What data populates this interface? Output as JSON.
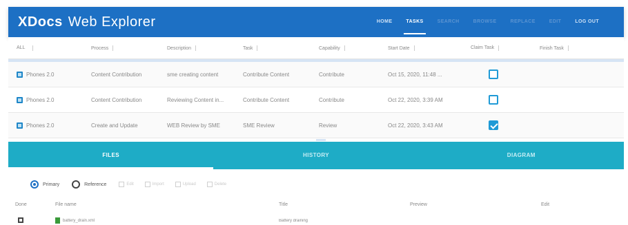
{
  "app": {
    "brand_bold": "XDocs",
    "brand_rest": "Web Explorer"
  },
  "nav": {
    "items": [
      {
        "label": "HOME",
        "state": "normal"
      },
      {
        "label": "TASKS",
        "state": "active"
      },
      {
        "label": "SEARCH",
        "state": "dim"
      },
      {
        "label": "BROWSE",
        "state": "dim"
      },
      {
        "label": "REPLACE",
        "state": "dim"
      },
      {
        "label": "EDIT",
        "state": "dim"
      },
      {
        "label": "LOG OUT",
        "state": "normal"
      }
    ]
  },
  "tasks": {
    "columns": [
      "ALL",
      "Process",
      "Description",
      "Task",
      "Capability",
      "Start Date",
      "Claim Task",
      "Finish Task"
    ],
    "rows": [
      {
        "doc": "Phones 2.0",
        "process": "Content Contribution",
        "description": "sme creating content",
        "task": "Contribute Content",
        "capability": "Contribute",
        "start": "Oct 15, 2020, 11:48 ...",
        "claimed": false
      },
      {
        "doc": "Phones 2.0",
        "process": "Content Contribution",
        "description": "Reviewing Content in...",
        "task": "Contribute Content",
        "capability": "Contribute",
        "start": "Oct 22, 2020, 3:39 AM",
        "claimed": false
      },
      {
        "doc": "Phones 2.0",
        "process": "Create and Update",
        "description": "WEB Review by SME",
        "task": "SME Review",
        "capability": "Review",
        "start": "Oct 22, 2020, 3:43 AM",
        "claimed": true
      }
    ]
  },
  "tabs": [
    {
      "label": "FILES",
      "active": true
    },
    {
      "label": "HISTORY",
      "active": false
    },
    {
      "label": "DIAGRAM",
      "active": false
    }
  ],
  "toolbar": {
    "radio_primary": "Primary",
    "radio_reference": "Reference",
    "actions": [
      "Edit",
      "Import",
      "Upload",
      "Delete"
    ]
  },
  "files": {
    "columns": [
      "Done",
      "File name",
      "Title",
      "Preview",
      "Edit"
    ],
    "rows": [
      {
        "filename": "battery_drain.xml",
        "title": "Battery draining"
      }
    ]
  },
  "colors": {
    "header": "#1d70c4",
    "tabs": "#1eacc6",
    "checkbox": "#1f9ad6"
  }
}
